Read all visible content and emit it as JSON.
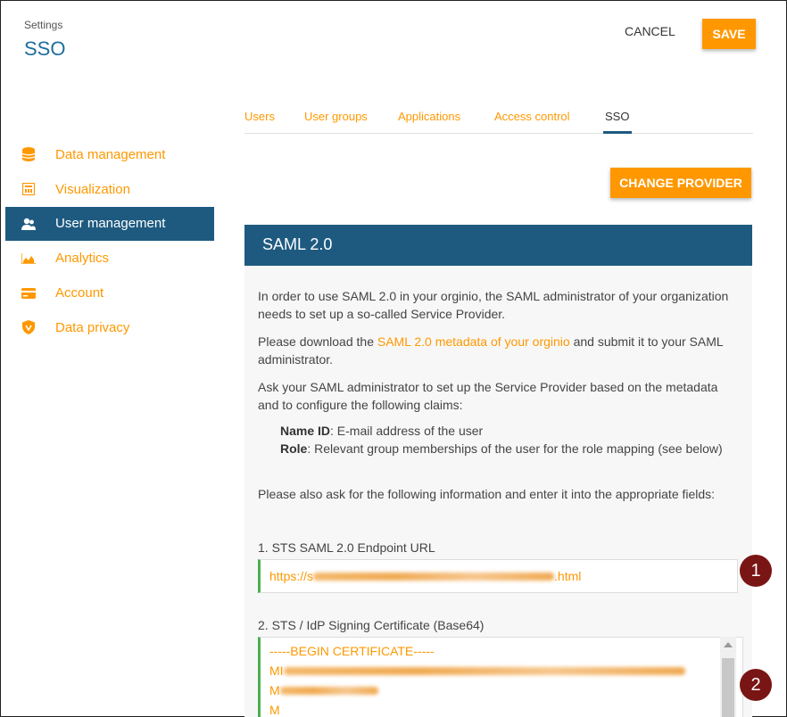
{
  "header": {
    "breadcrumb": "Settings",
    "title": "SSO"
  },
  "actions": {
    "cancel_label": "CANCEL",
    "save_label": "SAVE",
    "change_provider_label": "CHANGE PROVIDER"
  },
  "tabs": [
    {
      "label": "Users"
    },
    {
      "label": "User groups"
    },
    {
      "label": "Applications"
    },
    {
      "label": "Access control"
    },
    {
      "label": "SSO",
      "active": true
    }
  ],
  "sidebar": {
    "items": [
      {
        "label": "Data management",
        "icon": "database-icon"
      },
      {
        "label": "Visualization",
        "icon": "visualization-icon"
      },
      {
        "label": "User management",
        "icon": "user-management-icon",
        "active": true
      },
      {
        "label": "Analytics",
        "icon": "analytics-icon"
      },
      {
        "label": "Account",
        "icon": "credit-card-icon"
      },
      {
        "label": "Data privacy",
        "icon": "shield-icon"
      }
    ]
  },
  "saml": {
    "title": "SAML 2.0",
    "intro": "In order to use SAML 2.0 in your orginio, the SAML administrator of your organization needs to set up a so-called Service Provider.",
    "download_prefix": "Please download the ",
    "download_link": "SAML 2.0 metadata of your orginio",
    "download_suffix": " and submit it to your SAML administrator.",
    "claims_intro": "Ask your SAML administrator to set up the Service Provider based on the metadata and to configure the following claims:",
    "claim_name_id_label": "Name ID",
    "claim_name_id_text": ": E-mail address of the user",
    "claim_role_label": "Role",
    "claim_role_text": ": Relevant group memberships of the user for the role mapping (see below)",
    "info_request": "Please also ask for the following information and enter it into the appropriate fields:",
    "endpoint_label": "1. STS SAML 2.0 Endpoint URL",
    "endpoint_value_start": "https://s",
    "endpoint_value_end": ".html",
    "cert_label": "2. STS / IdP Signing Certificate (Base64)",
    "cert_line1": "-----BEGIN CERTIFICATE-----",
    "cert_line2": "MI",
    "cert_line3": "M",
    "cert_line4": "M"
  },
  "annotations": {
    "badge1": "1",
    "badge2": "2"
  },
  "colors": {
    "accent": "#ff9800",
    "primary": "#1e5a80",
    "badge": "#7a1515"
  }
}
